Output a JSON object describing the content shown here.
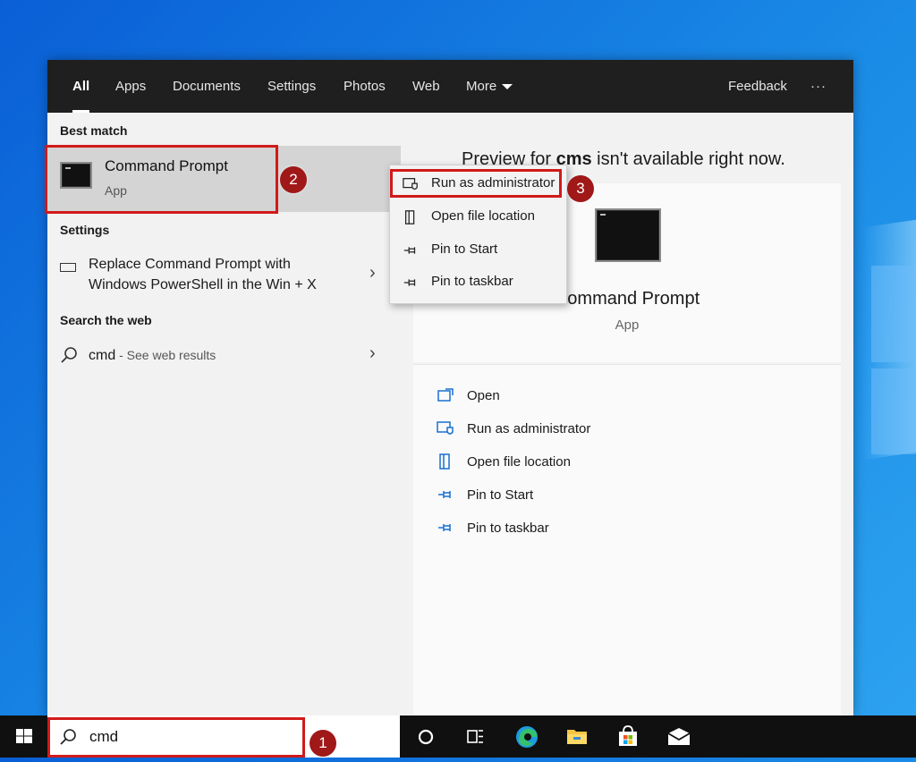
{
  "tabs": [
    {
      "label": "All",
      "active": true
    },
    {
      "label": "Apps"
    },
    {
      "label": "Documents"
    },
    {
      "label": "Settings"
    },
    {
      "label": "Photos"
    },
    {
      "label": "Web"
    },
    {
      "label": "More"
    }
  ],
  "topbar": {
    "feedback": "Feedback",
    "ellipsis": "···"
  },
  "sections": {
    "best_match": "Best match",
    "settings": "Settings",
    "search_web": "Search the web"
  },
  "best_match": {
    "title": "Command Prompt",
    "subtitle": "App"
  },
  "settings_item": {
    "line1": "Replace Command Prompt with",
    "line2": "Windows PowerShell in the Win + X"
  },
  "web_item": {
    "query": "cmd",
    "hint": " - See web results"
  },
  "context_menu": [
    {
      "label": "Run as administrator",
      "icon": "run-as-admin-icon"
    },
    {
      "label": "Open file location",
      "icon": "file-location-icon"
    },
    {
      "label": "Pin to Start",
      "icon": "pin-icon"
    },
    {
      "label": "Pin to taskbar",
      "icon": "pin-icon"
    }
  ],
  "preview": {
    "message_pre": "Preview for ",
    "message_term": "cms",
    "message_post": " isn't available right now.",
    "app_name": "Command Prompt",
    "app_type": "App"
  },
  "actions": [
    {
      "label": "Open",
      "icon": "open-icon"
    },
    {
      "label": "Run as administrator",
      "icon": "run-as-admin-icon"
    },
    {
      "label": "Open file location",
      "icon": "file-location-icon"
    },
    {
      "label": "Pin to Start",
      "icon": "pin-icon"
    },
    {
      "label": "Pin to taskbar",
      "icon": "pin-icon"
    }
  ],
  "taskbar": {
    "search_value": "cmd"
  },
  "callouts": [
    "1",
    "2",
    "3"
  ],
  "colors": {
    "accent_red": "#d11a1a",
    "badge": "#a01818",
    "topbar": "#1f1f1f",
    "taskbar": "#101010"
  }
}
